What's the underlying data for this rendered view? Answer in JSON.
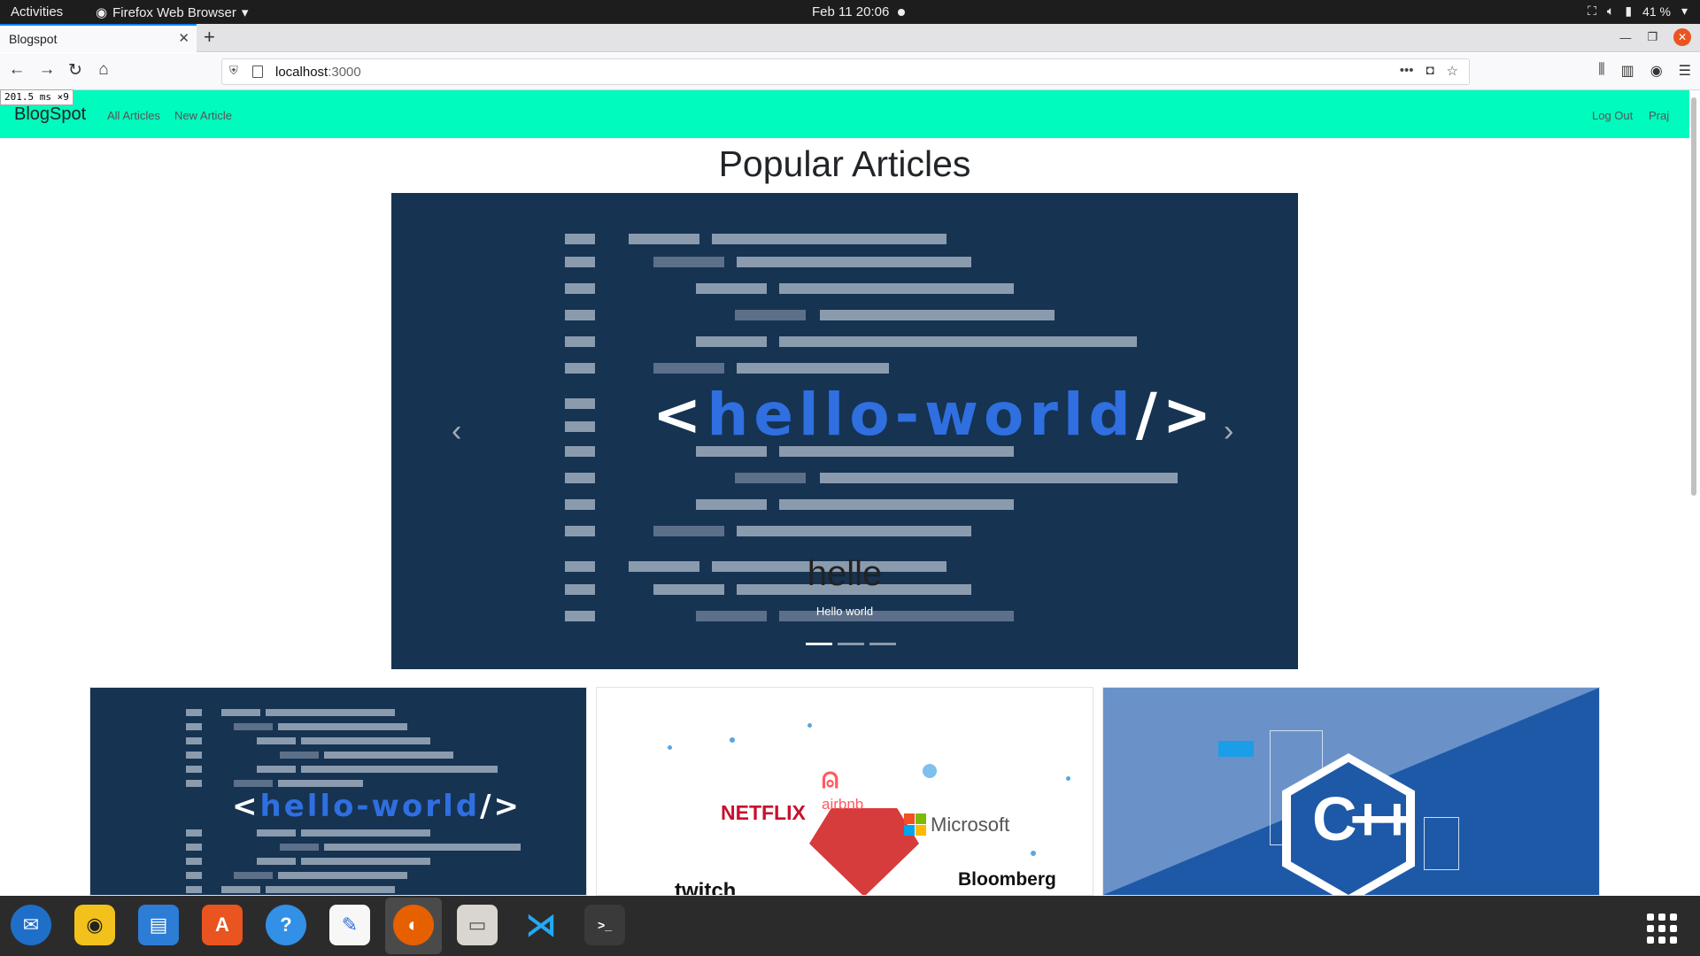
{
  "system": {
    "activities": "Activities",
    "app_name": "Firefox Web Browser",
    "clock": "Feb 11  20:06",
    "battery": "41 %"
  },
  "browser": {
    "tab_title": "Blogspot",
    "url_host": "localhost",
    "url_port": ":3000",
    "perf_readout": "201.5 ms ×9"
  },
  "site": {
    "brand": "BlogSpot",
    "nav": {
      "all_articles": "All Articles",
      "new_article": "New Article",
      "logout": "Log Out",
      "user": "Praj"
    },
    "heading": "Popular Articles",
    "carousel": {
      "slide_code_prefix": "<",
      "slide_code_main": "hello-world",
      "slide_code_suffix": "/>",
      "caption_title": "helle",
      "caption_text": "Hello world",
      "slide_count": 3,
      "active_slide": 1
    },
    "cards": [
      {
        "image": "hello-world-code",
        "code_prefix": "<",
        "code_main": "hello-world",
        "code_suffix": "/>"
      },
      {
        "image": "tech-company-logos",
        "logos": [
          "NETFLIX",
          "airbnb",
          "Microsoft",
          "Bloomberg",
          "twitch"
        ]
      },
      {
        "image": "cpp-logo",
        "logo_text": "C++"
      }
    ]
  },
  "dock": {
    "apps": [
      "thunderbird-icon",
      "rhythmbox-icon",
      "writer-icon",
      "software-icon",
      "help-icon",
      "text-editor-icon",
      "firefox-icon",
      "files-icon",
      "vscode-icon",
      "terminal-icon"
    ]
  },
  "colors": {
    "navbar_accent": "#00fbbe",
    "carousel_bg": "#163352",
    "code_blue": "#2f6fe0"
  }
}
